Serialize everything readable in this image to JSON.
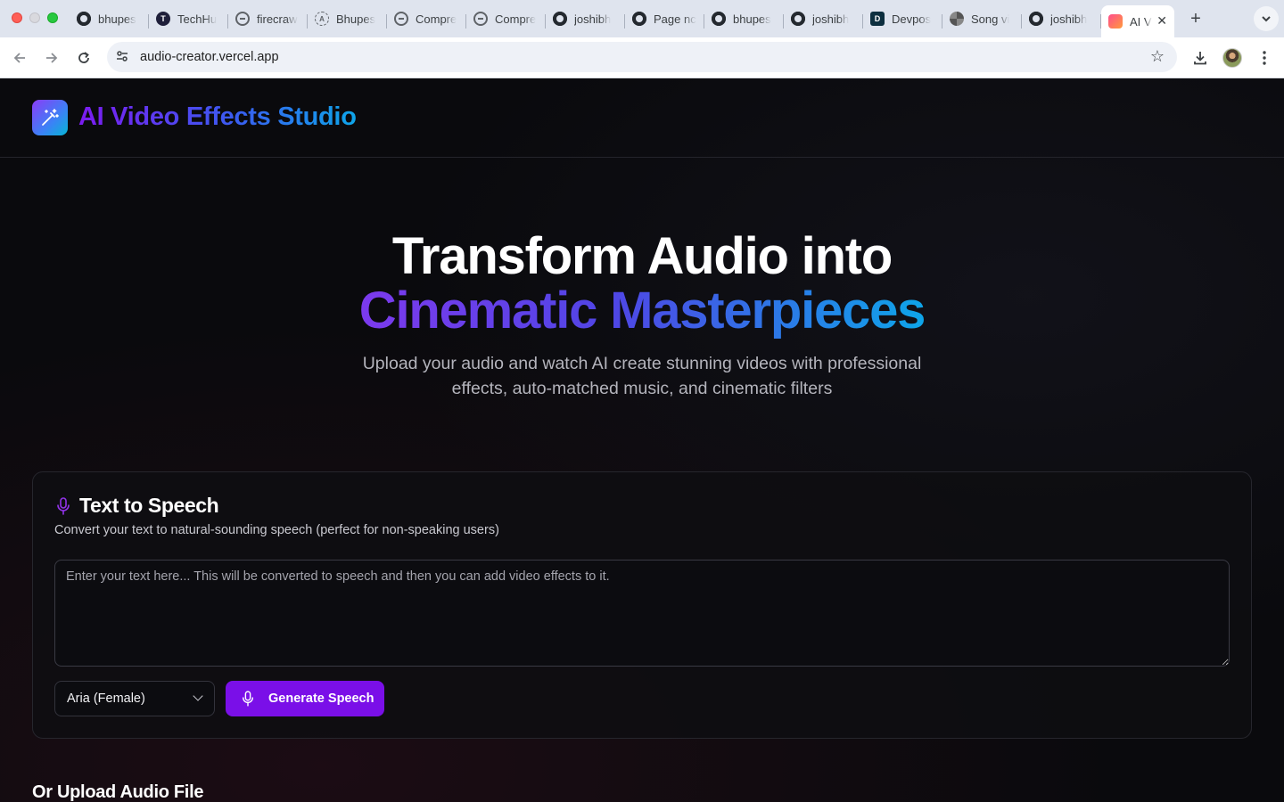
{
  "browser": {
    "tabs": [
      {
        "label": "bhupes",
        "icon": "github-icon"
      },
      {
        "label": "TechHu",
        "icon": "techhub-icon"
      },
      {
        "label": "firecraw",
        "icon": "globe-icon"
      },
      {
        "label": "Bhupes",
        "icon": "loading-icon"
      },
      {
        "label": "Compre",
        "icon": "globe-icon"
      },
      {
        "label": "Compre",
        "icon": "globe-icon"
      },
      {
        "label": "joshibh",
        "icon": "github-icon"
      },
      {
        "label": "Page nc",
        "icon": "github-icon"
      },
      {
        "label": "bhupes",
        "icon": "github-icon"
      },
      {
        "label": "joshibh",
        "icon": "github-icon"
      },
      {
        "label": "Devpos",
        "icon": "devpost-icon"
      },
      {
        "label": "Song vi",
        "icon": "openai-icon"
      },
      {
        "label": "joshibh",
        "icon": "github-icon"
      }
    ],
    "active_tab": {
      "label": "AI V",
      "icon": "app-favicon-icon"
    },
    "url": "audio-creator.vercel.app"
  },
  "site": {
    "title": "AI Video Effects Studio"
  },
  "hero": {
    "line1": "Transform Audio into",
    "line2": "Cinematic Masterpieces",
    "subtitle": "Upload your audio and watch AI create stunning videos with professional effects, auto-matched music, and cinematic filters"
  },
  "tts": {
    "title": "Text to Speech",
    "description": "Convert your text to natural-sounding speech (perfect for non-speaking users)",
    "placeholder": "Enter your text here... This will be converted to speech and then you can add video effects to it.",
    "voice": "Aria (Female)",
    "generate_label": "Generate Speech"
  },
  "upload": {
    "title": "Or Upload Audio File"
  },
  "colors": {
    "accent": "#7a0fe8",
    "gradient_start": "#7c3aed",
    "gradient_end": "#0ea5e9",
    "background": "#0a0a0d"
  }
}
